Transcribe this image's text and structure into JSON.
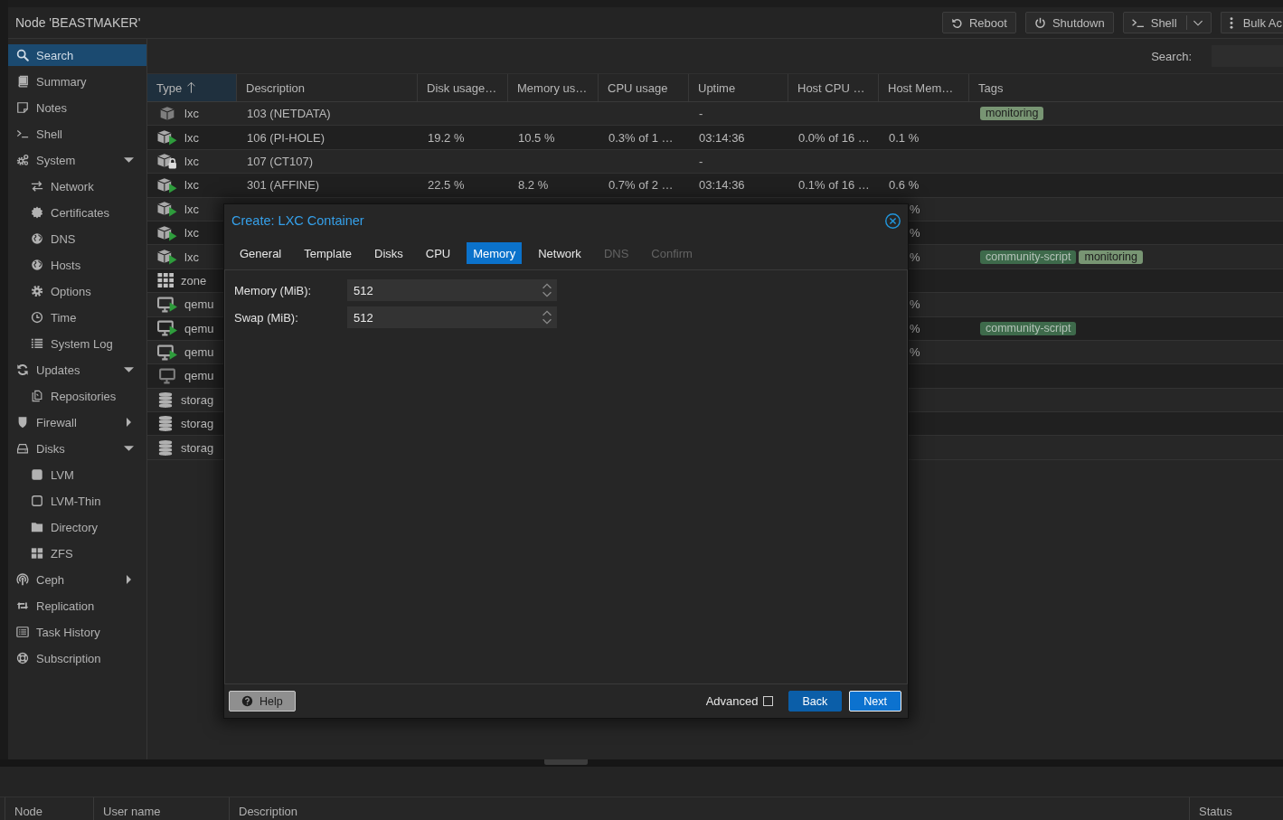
{
  "top_bar": {
    "title": "Node 'BEASTMAKER'",
    "buttons": [
      {
        "label": "Reboot",
        "kind": "plain"
      },
      {
        "label": "Shutdown",
        "kind": "plain"
      },
      {
        "label": "Shell",
        "kind": "split"
      },
      {
        "label": "Bulk Ac",
        "kind": "plain"
      }
    ]
  },
  "sidebar": {
    "items": [
      {
        "label": "Search",
        "selected": true
      },
      {
        "label": "Summary",
        "selected": false
      },
      {
        "label": "Notes",
        "selected": false
      },
      {
        "label": "Shell",
        "selected": false
      },
      {
        "label": "System",
        "selected": false,
        "expanded": true,
        "children": [
          {
            "label": "Network",
            "selected": false
          },
          {
            "label": "Certificates",
            "selected": false
          },
          {
            "label": "DNS",
            "selected": false
          },
          {
            "label": "Hosts",
            "selected": false
          },
          {
            "label": "Options",
            "selected": false
          },
          {
            "label": "Time",
            "selected": false
          },
          {
            "label": "System Log",
            "selected": false
          }
        ]
      },
      {
        "label": "Updates",
        "selected": false,
        "expanded": true,
        "children": [
          {
            "label": "Repositories",
            "selected": false
          }
        ]
      },
      {
        "label": "Firewall",
        "selected": false,
        "expanded": false
      },
      {
        "label": "Disks",
        "selected": false,
        "expanded": true,
        "children": [
          {
            "label": "LVM",
            "selected": false
          },
          {
            "label": "LVM-Thin",
            "selected": false
          },
          {
            "label": "Directory",
            "selected": false
          },
          {
            "label": "ZFS",
            "selected": false
          }
        ]
      },
      {
        "label": "Ceph",
        "selected": false,
        "expanded": false
      },
      {
        "label": "Replication",
        "selected": false
      },
      {
        "label": "Task History",
        "selected": false
      },
      {
        "label": "Subscription",
        "selected": false
      }
    ]
  },
  "toolbar": {
    "search_label": "Search:"
  },
  "table": {
    "columns": [
      {
        "label": "Type",
        "sorted": true
      },
      {
        "label": "Description",
        "sorted": false
      },
      {
        "label": "Disk usage…",
        "sorted": false
      },
      {
        "label": "Memory us…",
        "sorted": false
      },
      {
        "label": "CPU usage",
        "sorted": false
      },
      {
        "label": "Uptime",
        "sorted": false
      },
      {
        "label": "Host CPU …",
        "sorted": false
      },
      {
        "label": "Host Mem…",
        "sorted": false
      },
      {
        "label": "Tags",
        "sorted": false
      }
    ],
    "rows": [
      {
        "kind": "lxc",
        "running": false,
        "locked": false,
        "type": "lxc",
        "description": "103 (NETDATA)",
        "uptime": "-",
        "tags": [
          {
            "label": "monitoring",
            "color": "#789573"
          }
        ]
      },
      {
        "kind": "lxc",
        "running": true,
        "locked": false,
        "type": "lxc",
        "description": "106 (PI-HOLE)",
        "disk_usage": "19.2 %",
        "memory_usage": "10.5 %",
        "cpu_usage": "0.3% of 1 …",
        "uptime": "03:14:36",
        "host_cpu": "0.0% of 16 …",
        "host_memory": "0.1 %"
      },
      {
        "kind": "lxc",
        "running": false,
        "locked": true,
        "type": "lxc",
        "description": "107 (CT107)",
        "uptime": "-"
      },
      {
        "kind": "lxc",
        "running": true,
        "locked": false,
        "type": "lxc",
        "description": "301 (AFFINE)",
        "disk_usage": "22.5 %",
        "memory_usage": "8.2 %",
        "cpu_usage": "0.7% of 2 …",
        "uptime": "03:14:36",
        "host_cpu": "0.1% of 16 …",
        "host_memory": "0.6 %"
      },
      {
        "kind": "lxc",
        "running": true,
        "locked": false,
        "type": "lxc",
        "host_memory": "%"
      },
      {
        "kind": "lxc",
        "running": true,
        "locked": false,
        "type": "lxc",
        "host_memory": "%"
      },
      {
        "kind": "lxc",
        "running": true,
        "locked": false,
        "type": "lxc",
        "host_memory": "%",
        "tags": [
          {
            "label": "community-script",
            "color": "#3e6a4b"
          },
          {
            "label": "monitoring",
            "color": "#789573"
          }
        ]
      },
      {
        "kind": "zone",
        "type": "zone"
      },
      {
        "kind": "qemu",
        "running": true,
        "type": "qemu",
        "host_memory": "%"
      },
      {
        "kind": "qemu",
        "running": true,
        "type": "qemu",
        "host_memory": "%",
        "tags": [
          {
            "label": "community-script",
            "color": "#3e6a4b"
          }
        ]
      },
      {
        "kind": "qemu",
        "running": true,
        "type": "qemu",
        "host_memory": "%"
      },
      {
        "kind": "qemu",
        "running": false,
        "type": "qemu"
      },
      {
        "kind": "storage",
        "type": "storag"
      },
      {
        "kind": "storage",
        "type": "storag"
      },
      {
        "kind": "storage",
        "type": "storag"
      }
    ]
  },
  "dialog": {
    "title": "Create: LXC Container",
    "tabs": [
      {
        "label": "General",
        "selected": false,
        "disabled": false
      },
      {
        "label": "Template",
        "selected": false,
        "disabled": false
      },
      {
        "label": "Disks",
        "selected": false,
        "disabled": false
      },
      {
        "label": "CPU",
        "selected": false,
        "disabled": false
      },
      {
        "label": "Memory",
        "selected": true,
        "disabled": false
      },
      {
        "label": "Network",
        "selected": false,
        "disabled": false
      },
      {
        "label": "DNS",
        "selected": false,
        "disabled": true
      },
      {
        "label": "Confirm",
        "selected": false,
        "disabled": true
      }
    ],
    "fields": [
      {
        "label": "Memory (MiB):",
        "value": "512"
      },
      {
        "label": "Swap (MiB):",
        "value": "512"
      }
    ],
    "footer": {
      "help": "Help",
      "advanced": {
        "label": "Advanced",
        "checked": false
      },
      "buttons": [
        {
          "label": "Back",
          "focused": false
        },
        {
          "label": "Next",
          "focused": true
        }
      ]
    }
  },
  "task_log": {
    "columns": [
      {
        "label": "Node"
      },
      {
        "label": "User name"
      },
      {
        "label": "Description"
      },
      {
        "label": "Status"
      }
    ]
  }
}
